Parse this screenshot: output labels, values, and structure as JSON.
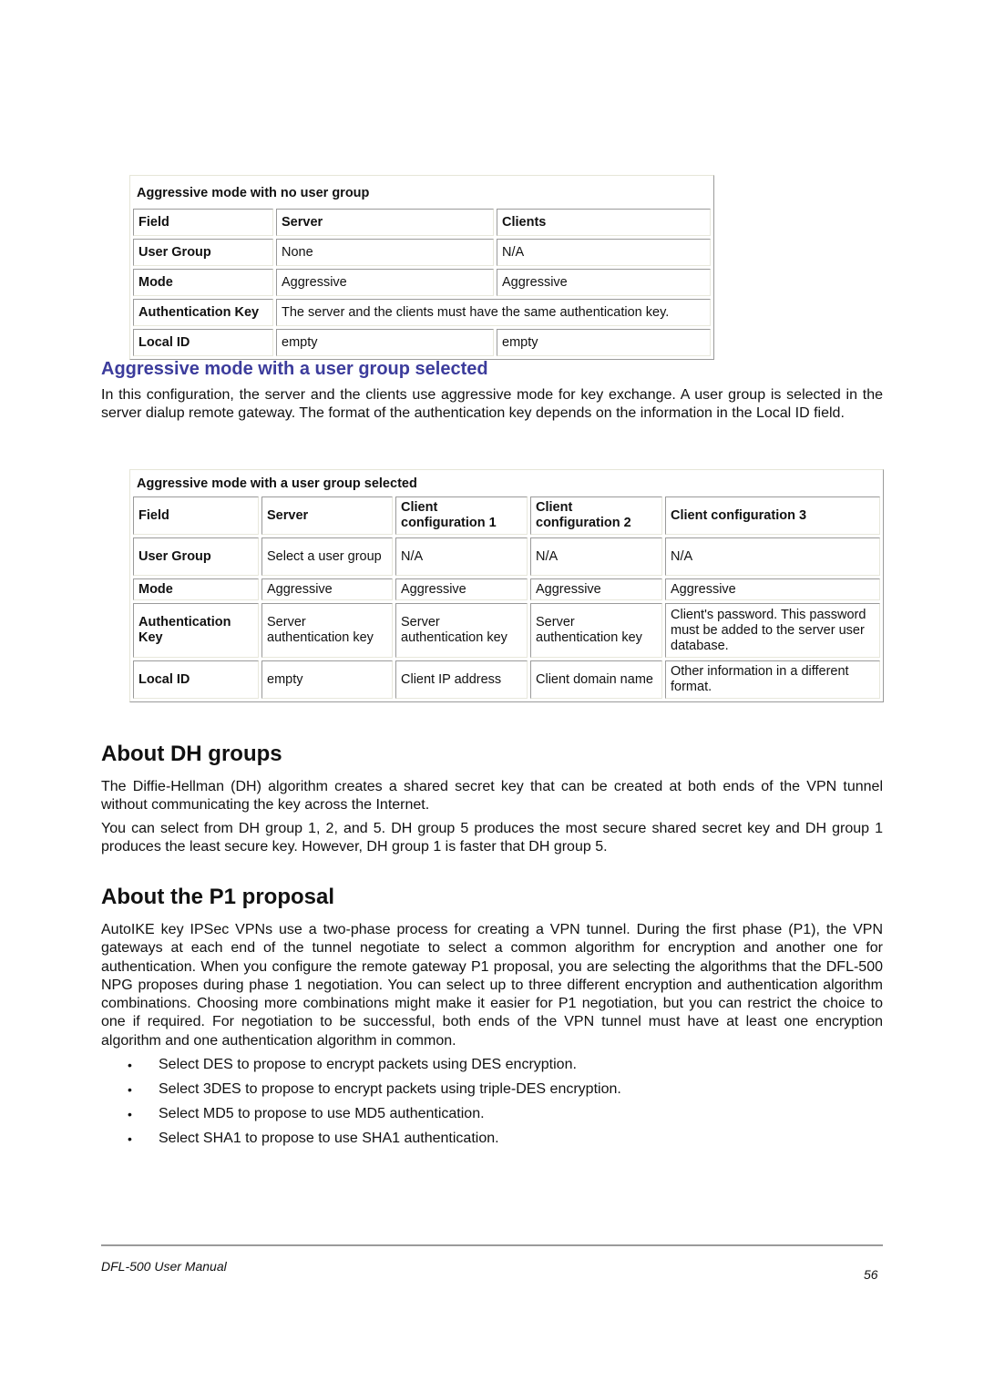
{
  "table_no_group": {
    "caption": "Aggressive mode with no user group",
    "headers": [
      "Field",
      "Server",
      "Clients"
    ],
    "rows": [
      {
        "field": "User Group",
        "server": "None",
        "clients": "N/A"
      },
      {
        "field": "Mode",
        "server": "Aggressive",
        "clients": "Aggressive"
      },
      {
        "field": "Authentication Key",
        "merged": "The server and the clients must have the same authentication key."
      },
      {
        "field": "Local ID",
        "server": "empty",
        "clients": "empty"
      }
    ]
  },
  "section_user_group": {
    "heading": "Aggressive mode with a user group selected",
    "paragraph": "In this configuration, the server and the clients use aggressive mode for key exchange. A user group is selected in the server dialup remote gateway. The format of the authentication key depends on the information in the Local ID field."
  },
  "table_user_group": {
    "caption": "Aggressive mode with a user group selected",
    "headers": [
      "Field",
      "Server",
      "Client configuration 1",
      "Client configuration 2",
      "Client configuration 3"
    ],
    "rows": [
      [
        "User Group",
        "Select a user group",
        "N/A",
        "N/A",
        "N/A"
      ],
      [
        "Mode",
        "Aggressive",
        "Aggressive",
        "Aggressive",
        "Aggressive"
      ],
      [
        "Authentication Key",
        "Server authentication key",
        "Server authentication key",
        "Server authentication key",
        "Client's password. This password must be added to the server user database."
      ],
      [
        "Local ID",
        "empty",
        "Client IP address",
        "Client domain name",
        "Other information in a different format."
      ]
    ]
  },
  "section_dh": {
    "heading": "About DH groups",
    "paragraphs": [
      "The Diffie-Hellman (DH) algorithm creates a shared secret key that can be created at both ends of the VPN tunnel without communicating the key across the Internet.",
      "You can select from DH group 1, 2, and 5. DH group 5 produces the most secure shared secret key and DH group 1 produces the least secure key. However, DH group 1 is faster that DH group 5."
    ]
  },
  "section_p1": {
    "heading": "About the P1 proposal",
    "paragraph": "AutoIKE key IPSec VPNs use a two-phase process for creating a VPN tunnel. During the first phase (P1), the VPN gateways at each end of the tunnel negotiate to select a common algorithm for encryption and another one for authentication. When you configure the remote gateway P1 proposal, you are selecting the algorithms that the DFL-500 NPG proposes during phase 1 negotiation. You can select up to three different encryption and authentication algorithm combinations. Choosing more combinations might make it easier for P1 negotiation, but you can restrict the choice to one if required. For negotiation to be successful, both ends of the VPN tunnel must have at least one encryption algorithm and one authentication algorithm in common.",
    "bullets": [
      "Select DES to propose to encrypt packets using DES encryption.",
      "Select 3DES to propose to encrypt packets using triple-DES encryption.",
      "Select MD5 to propose to use MD5 authentication.",
      "Select SHA1 to propose to use SHA1 authentication."
    ],
    "bullet_glyph": "•"
  },
  "footer": {
    "manual_title": "DFL-500 User Manual",
    "page_number": "56"
  }
}
